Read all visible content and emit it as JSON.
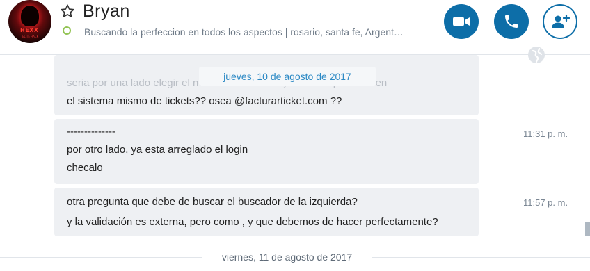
{
  "contact": {
    "name": "Bryan",
    "avatar_logo": "HEXX",
    "avatar_logo_sub": "ELITE HACK",
    "mood": "Buscando la perfeccion en todos los aspectos  |  rosario, santa fe, Argent…",
    "status_color": "#92c353"
  },
  "header": {
    "buttons": [
      {
        "name": "video-call-button",
        "icon": "video-camera-icon"
      },
      {
        "name": "voice-call-button",
        "icon": "phone-icon"
      },
      {
        "name": "add-people-button",
        "icon": "add-person-icon"
      }
    ]
  },
  "conversation": {
    "sticky_date": "jueves, 10 de agosto de 2017",
    "messages": [
      {
        "lines": [
          "seria por una lado elegir el nombre de usuario y el email q se crea en",
          "el sistema mismo de tickets?? osea @facturarticket.com ??"
        ],
        "time": ""
      },
      {
        "lines": [
          "--------------",
          "por otro lado, ya esta arreglado el login",
          "checalo"
        ],
        "time": "11:31 p. m."
      },
      {
        "lines": [
          "otra pregunta que debe de buscar  el buscador de la izquierda?",
          "y la validación es externa, pero como , y que debemos de hacer perfectamente?"
        ],
        "time": "11:57 p. m."
      }
    ],
    "next_date": "viernes, 11 de agosto de 2017"
  },
  "colors": {
    "accent": "#0d6ea8",
    "bubble_bg": "#eef0f3",
    "date_text": "#2d8ac5"
  }
}
